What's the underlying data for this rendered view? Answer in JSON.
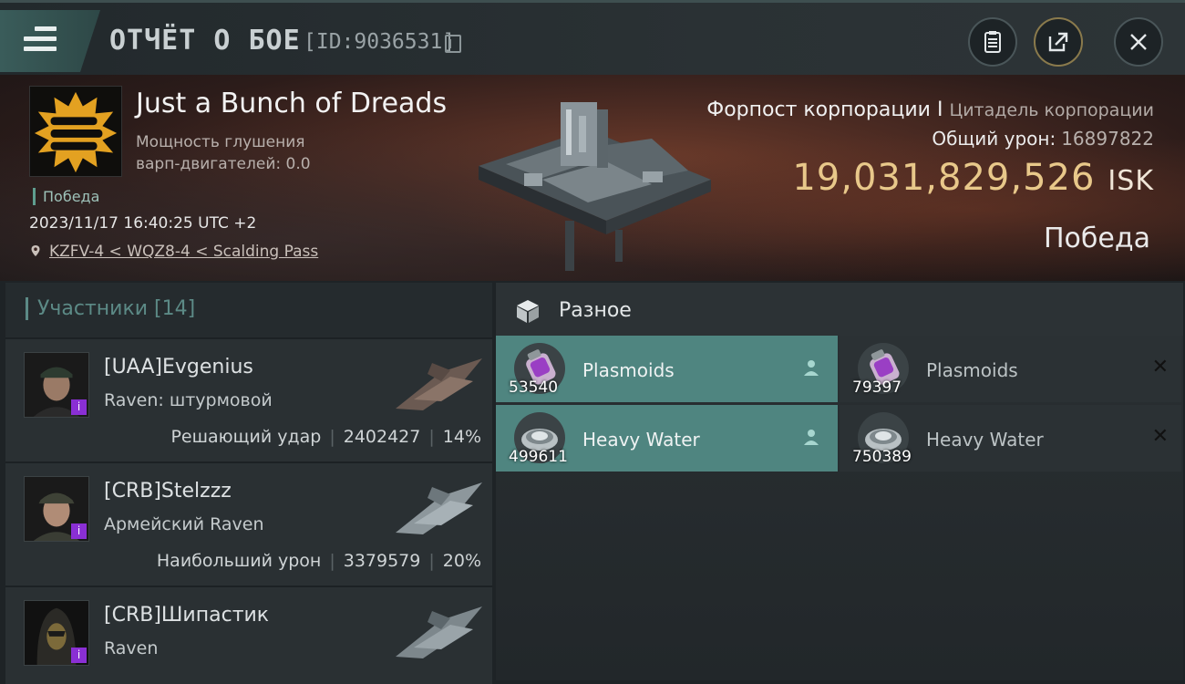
{
  "header": {
    "title": "ОТЧЁТ О БОЕ",
    "report_id": "[ID:9036531]"
  },
  "banner": {
    "corp_name": "Just a Bunch of Dreads",
    "warp_label": "Мощность глушения",
    "warp_value": "варп-двигателей: 0.0",
    "status_tag": "Победа",
    "datetime": "2023/11/17 16:40:25 UTC +2",
    "location": "KZFV-4 < WQZ8-4 < Scalding Pass",
    "target_name": "Форпост корпорации I",
    "target_type": "Цитадель корпорации",
    "damage_label": "Общий урон:",
    "damage_value": "16897822",
    "isk_value": "19,031,829,526",
    "isk_unit": "ISK",
    "result": "Победа"
  },
  "participants": {
    "title": "Участники [14]",
    "rows": [
      {
        "name": "[UAA]Evgenius",
        "ship": "Raven: штурмовой",
        "role": "Решающий удар",
        "damage": "2402427",
        "percent": "14%"
      },
      {
        "name": "[CRB]Stelzzz",
        "ship": "Армейский Raven",
        "role": "Наибольший урон",
        "damage": "3379579",
        "percent": "20%"
      },
      {
        "name": "[CRB]Шипастик",
        "ship": "Raven",
        "role": "",
        "damage": "",
        "percent": ""
      }
    ]
  },
  "items": {
    "title": "Разное",
    "list": [
      {
        "name": "Plasmoids",
        "qty": "53540",
        "highlighted": true,
        "icon": "canister-icon"
      },
      {
        "name": "Plasmoids",
        "qty": "79397",
        "highlighted": false,
        "icon": "canister-icon"
      },
      {
        "name": "Heavy Water",
        "qty": "499611",
        "highlighted": true,
        "icon": "isotope-icon"
      },
      {
        "name": "Heavy Water",
        "qty": "750389",
        "highlighted": false,
        "icon": "isotope-icon"
      }
    ]
  },
  "colors": {
    "accent_teal": "#4f8580",
    "isk_gold": "#e8c88a",
    "badge_purple": "#8a2fd4"
  }
}
